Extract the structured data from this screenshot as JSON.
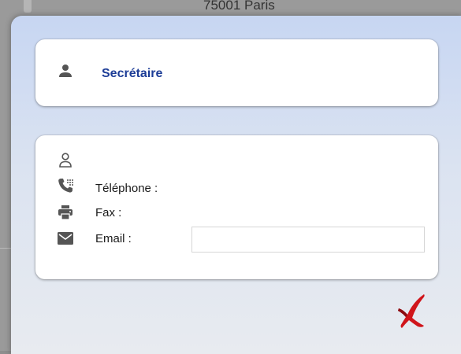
{
  "background": {
    "partial_text": "75001 Paris"
  },
  "role_card": {
    "icon": "person-icon",
    "label": "Secrétaire"
  },
  "contact_card": {
    "person_icon": "person-outline-icon",
    "telephone_label": "Téléphone :",
    "telephone_icon": "phone-icon",
    "fax_label": "Fax :",
    "fax_icon": "printer-icon",
    "email_label": "Email :",
    "email_icon": "mail-icon",
    "email_value": ""
  },
  "close_button": {
    "icon": "red-x-close-icon",
    "color": "#d0151b"
  },
  "colors": {
    "role_label": "#1d3d97",
    "dialog_top": "#c7d6f2",
    "dialog_bottom": "#e8ebf0"
  }
}
